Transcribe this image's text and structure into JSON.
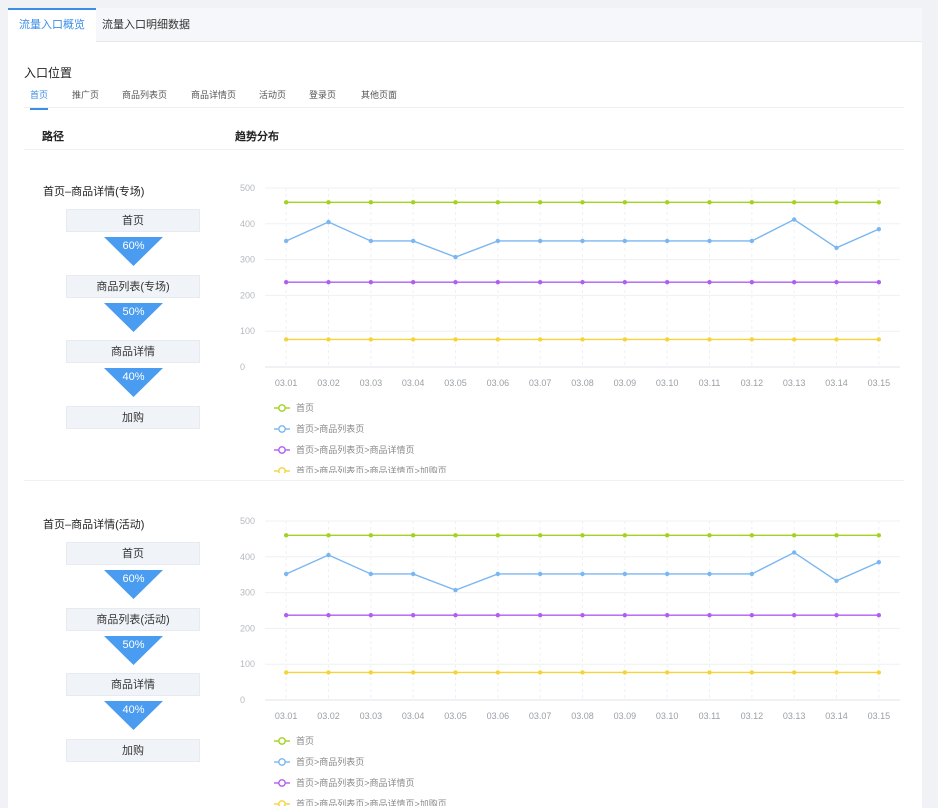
{
  "tabs": [
    {
      "label": "流量入口概览",
      "active": true
    },
    {
      "label": "流量入口明细数据",
      "active": false
    }
  ],
  "section_title": "入口位置",
  "sub_tabs": [
    {
      "label": "首页",
      "active": true
    },
    {
      "label": "推广页",
      "active": false
    },
    {
      "label": "商品列表页",
      "active": false
    },
    {
      "label": "商品详情页",
      "active": false
    },
    {
      "label": "活动页",
      "active": false
    },
    {
      "label": "登录页",
      "active": false
    },
    {
      "label": "其他页面",
      "active": false
    }
  ],
  "headers": {
    "path": "路径",
    "trend": "趋势分布"
  },
  "colors": {
    "accent": "#3a8ee6",
    "arrow": "#4a9cf0",
    "series": [
      "#a3d21f",
      "#7ab7f0",
      "#b05ef0",
      "#f5d33a"
    ]
  },
  "blocks": [
    {
      "title": "首页–商品详情(专场)",
      "steps": [
        "首页",
        "商品列表(专场)",
        "商品详情",
        "加购"
      ],
      "rates": [
        "60%",
        "50%",
        "40%"
      ]
    },
    {
      "title": "首页–商品详情(活动)",
      "steps": [
        "首页",
        "商品列表(活动)",
        "商品详情",
        "加购"
      ],
      "rates": [
        "60%",
        "50%",
        "40%"
      ]
    }
  ],
  "chart_data": [
    {
      "type": "line",
      "x": [
        "03.01",
        "03.02",
        "03.03",
        "03.04",
        "03.05",
        "03.06",
        "03.07",
        "03.08",
        "03.09",
        "03.10",
        "03.11",
        "03.12",
        "03.13",
        "03.14",
        "03.15"
      ],
      "ylim": [
        0,
        500
      ],
      "yticks": [
        0,
        100,
        200,
        300,
        400,
        500
      ],
      "grid": true,
      "legend_position": "bottom-left",
      "series": [
        {
          "name": "首页",
          "values": [
            460,
            460,
            460,
            460,
            460,
            460,
            460,
            460,
            460,
            460,
            460,
            460,
            460,
            460,
            460
          ]
        },
        {
          "name": "首页>商品列表页",
          "values": [
            352,
            405,
            352,
            352,
            307,
            352,
            352,
            352,
            352,
            352,
            352,
            352,
            412,
            333,
            385
          ]
        },
        {
          "name": "首页>商品列表页>商品详情页",
          "values": [
            237,
            237,
            237,
            237,
            237,
            237,
            237,
            237,
            237,
            237,
            237,
            237,
            237,
            237,
            237
          ]
        },
        {
          "name": "首页>商品列表页>商品详情页>加购页",
          "values": [
            77,
            77,
            77,
            77,
            77,
            77,
            77,
            77,
            77,
            77,
            77,
            77,
            77,
            77,
            77
          ]
        }
      ]
    },
    {
      "type": "line",
      "x": [
        "03.01",
        "03.02",
        "03.03",
        "03.04",
        "03.05",
        "03.06",
        "03.07",
        "03.08",
        "03.09",
        "03.10",
        "03.11",
        "03.12",
        "03.13",
        "03.14",
        "03.15"
      ],
      "ylim": [
        0,
        500
      ],
      "yticks": [
        0,
        100,
        200,
        300,
        400,
        500
      ],
      "grid": true,
      "legend_position": "bottom-left",
      "series": [
        {
          "name": "首页",
          "values": [
            460,
            460,
            460,
            460,
            460,
            460,
            460,
            460,
            460,
            460,
            460,
            460,
            460,
            460,
            460
          ]
        },
        {
          "name": "首页>商品列表页",
          "values": [
            352,
            405,
            352,
            352,
            307,
            352,
            352,
            352,
            352,
            352,
            352,
            352,
            412,
            333,
            385
          ]
        },
        {
          "name": "首页>商品列表页>商品详情页",
          "values": [
            237,
            237,
            237,
            237,
            237,
            237,
            237,
            237,
            237,
            237,
            237,
            237,
            237,
            237,
            237
          ]
        },
        {
          "name": "首页>商品列表页>商品详情页>加购页",
          "values": [
            77,
            77,
            77,
            77,
            77,
            77,
            77,
            77,
            77,
            77,
            77,
            77,
            77,
            77,
            77
          ]
        }
      ]
    }
  ]
}
